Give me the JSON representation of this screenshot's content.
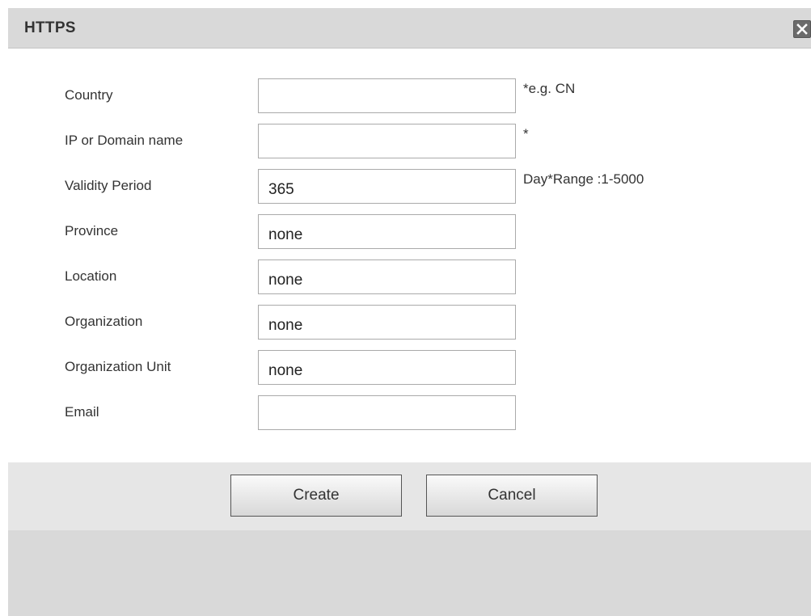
{
  "dialog": {
    "title": "HTTPS"
  },
  "form": {
    "fields": [
      {
        "label": "Country",
        "value": "",
        "hint": "*e.g. CN"
      },
      {
        "label": "IP or Domain name",
        "value": "",
        "hint": "*"
      },
      {
        "label": "Validity Period",
        "value": "365",
        "hint": "Day*Range :1-5000"
      },
      {
        "label": "Province",
        "value": "none",
        "hint": ""
      },
      {
        "label": "Location",
        "value": "none",
        "hint": ""
      },
      {
        "label": "Organization",
        "value": "none",
        "hint": ""
      },
      {
        "label": "Organization Unit",
        "value": "none",
        "hint": ""
      },
      {
        "label": "Email",
        "value": "",
        "hint": ""
      }
    ]
  },
  "buttons": {
    "create_label": "Create",
    "cancel_label": "Cancel"
  },
  "icons": {
    "close": "close-icon"
  },
  "colors": {
    "title_bar": "#d9d9d9",
    "button_bar": "#e6e6e6",
    "footer": "#d9d9d9",
    "close_button": "#6b6b6b"
  }
}
